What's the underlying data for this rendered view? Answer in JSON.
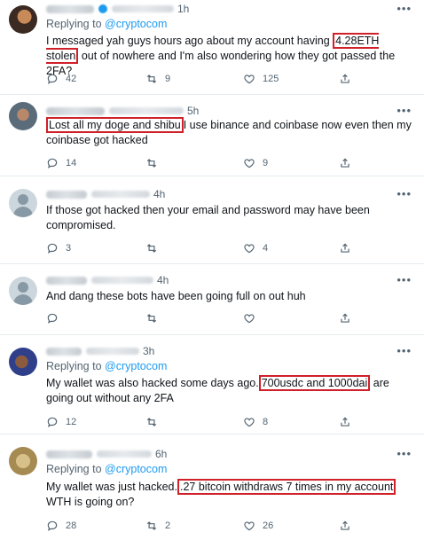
{
  "tweets": [
    {
      "time": "1h",
      "reply_prefix": "Replying to ",
      "reply_handle": "@cryptocom",
      "text_before": "I messaged yah guys hours ago about my account having ",
      "highlight": "4.28ETH stolen",
      "text_after": " out of nowhere and I'm also wondering how they got passed the 2FA?",
      "replies": "42",
      "retweets": "9",
      "likes": "125"
    },
    {
      "time": "5h",
      "reply_prefix": "",
      "reply_handle": "",
      "text_before": "",
      "highlight": "Lost all my doge and shibu",
      "text_after": "I use binance and coinbase now even then my coinbase got hacked",
      "replies": "14",
      "retweets": "",
      "likes": "9"
    },
    {
      "time": "4h",
      "reply_prefix": "",
      "reply_handle": "",
      "text_before": "If those got hacked then your email and password may have been compromised.",
      "highlight": "",
      "text_after": "",
      "replies": "3",
      "retweets": "",
      "likes": "4"
    },
    {
      "time": "4h",
      "reply_prefix": "",
      "reply_handle": "",
      "text_before": "And dang these bots have been going full on out huh",
      "highlight": "",
      "text_after": "",
      "replies": "",
      "retweets": "",
      "likes": ""
    },
    {
      "time": "3h",
      "reply_prefix": "Replying to ",
      "reply_handle": "@cryptocom",
      "text_before": "My wallet was also hacked some days ago.",
      "highlight": "700usdc and 1000dai",
      "text_after": " are going out without any 2FA",
      "replies": "12",
      "retweets": "",
      "likes": "8"
    },
    {
      "time": "6h",
      "reply_prefix": "Replying to ",
      "reply_handle": "@cryptocom",
      "text_before": "My wallet was just hacked.",
      "highlight": ".27 bitcoin withdraws 7 times in my account",
      "text_after": " WTH is going on?",
      "replies": "28",
      "retweets": "2",
      "likes": "26"
    }
  ],
  "more_label": "•••",
  "colors": {
    "link": "#1d9bf0",
    "highlight_box": "#d0202a",
    "muted": "#536471"
  }
}
